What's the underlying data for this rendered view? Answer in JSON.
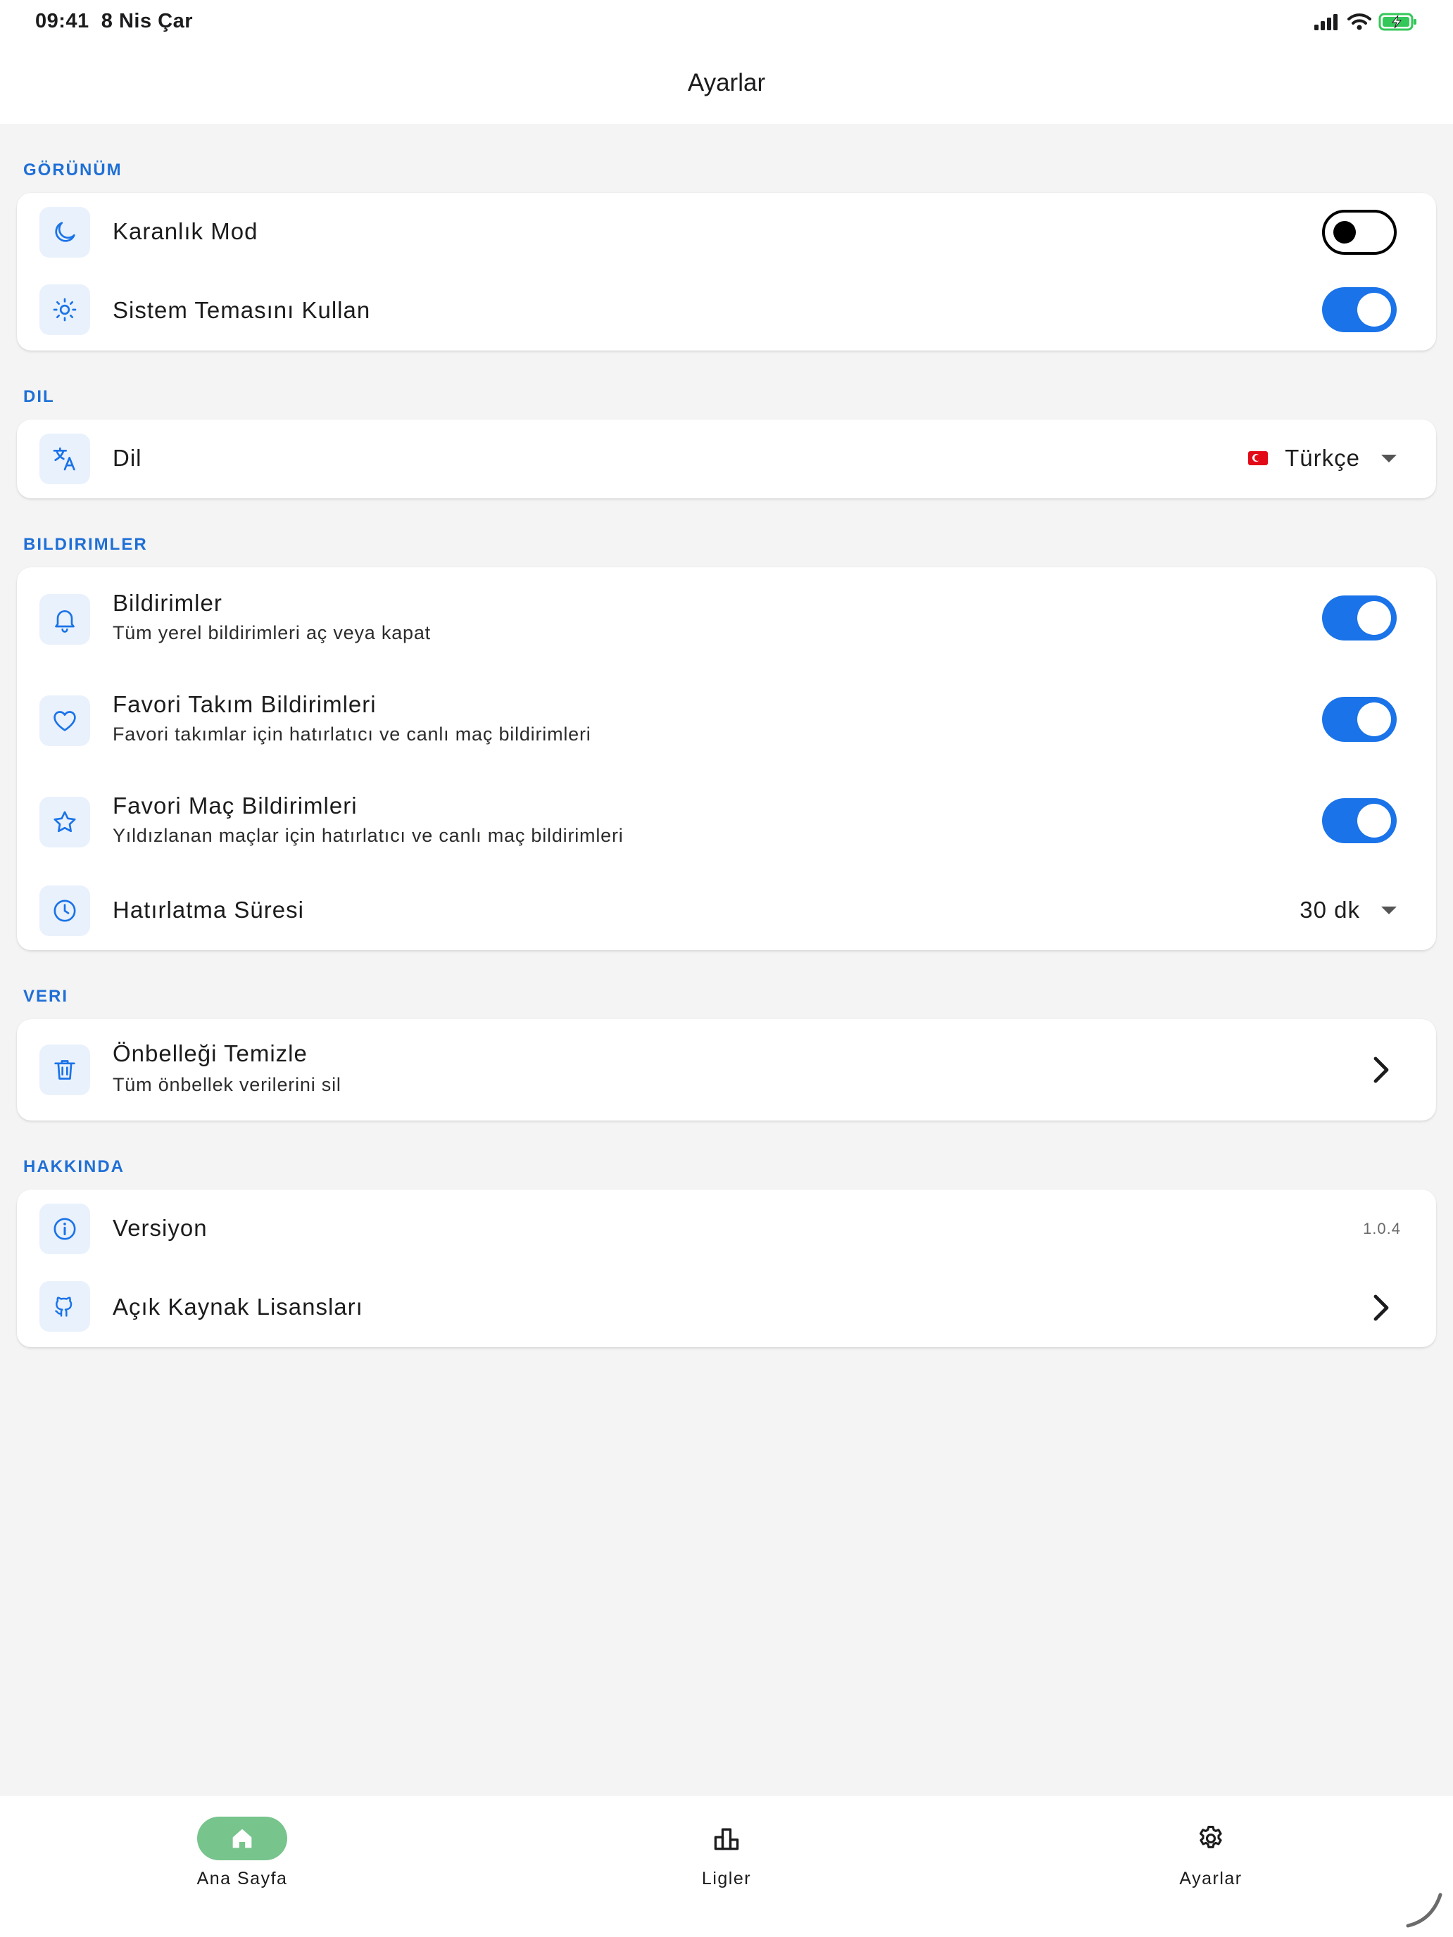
{
  "status_bar": {
    "time": "09:41",
    "date": "8 Nis Çar"
  },
  "header": {
    "title": "Ayarlar"
  },
  "sections": {
    "appearance": {
      "label": "GÖRÜNÜM",
      "dark_mode": {
        "title": "Karanlık Mod",
        "icon": "moon-icon",
        "enabled": false
      },
      "system_theme": {
        "title": "Sistem Temasını Kullan",
        "icon": "sun-icon",
        "enabled": true
      }
    },
    "language": {
      "label": "DIL",
      "language": {
        "title": "Dil",
        "icon": "translate-icon",
        "value": "Türkçe",
        "flag": "turkey-flag"
      }
    },
    "notifications": {
      "label": "BILDIRIMLER",
      "all": {
        "title": "Bildirimler",
        "subtitle": "Tüm yerel bildirimleri aç veya kapat",
        "icon": "bell-icon",
        "enabled": true
      },
      "favorite_teams": {
        "title": "Favori Takım Bildirimleri",
        "subtitle": "Favori takımlar için hatırlatıcı ve canlı maç bildirimleri",
        "icon": "heart-icon",
        "enabled": true
      },
      "favorite_matches": {
        "title": "Favori Maç Bildirimleri",
        "subtitle": "Yıldızlanan maçlar için hatırlatıcı ve canlı maç bildirimleri",
        "icon": "star-icon",
        "enabled": true
      },
      "reminder": {
        "title": "Hatırlatma Süresi",
        "icon": "clock-icon",
        "value": "30 dk"
      }
    },
    "data": {
      "label": "VERI",
      "clear_cache": {
        "title": "Önbelleği Temizle",
        "subtitle": "Tüm önbellek verilerini sil",
        "icon": "trash-icon"
      }
    },
    "about": {
      "label": "HAKKINDA",
      "version": {
        "title": "Versiyon",
        "icon": "info-icon",
        "value": "1.0.4"
      },
      "licenses": {
        "title": "Açık Kaynak Lisansları",
        "icon": "github-icon"
      }
    }
  },
  "bottom_nav": {
    "items": [
      {
        "label": "Ana Sayfa",
        "icon": "home-icon",
        "active": true
      },
      {
        "label": "Ligler",
        "icon": "leaderboard-icon",
        "active": false
      },
      {
        "label": "Ayarlar",
        "icon": "gear-icon",
        "active": false
      }
    ]
  },
  "colors": {
    "accent": "#1a73e8",
    "section_label": "#1f6fd6",
    "icon_bg": "#e9f1fc",
    "nav_active": "#77c48c",
    "battery": "#34c759"
  }
}
